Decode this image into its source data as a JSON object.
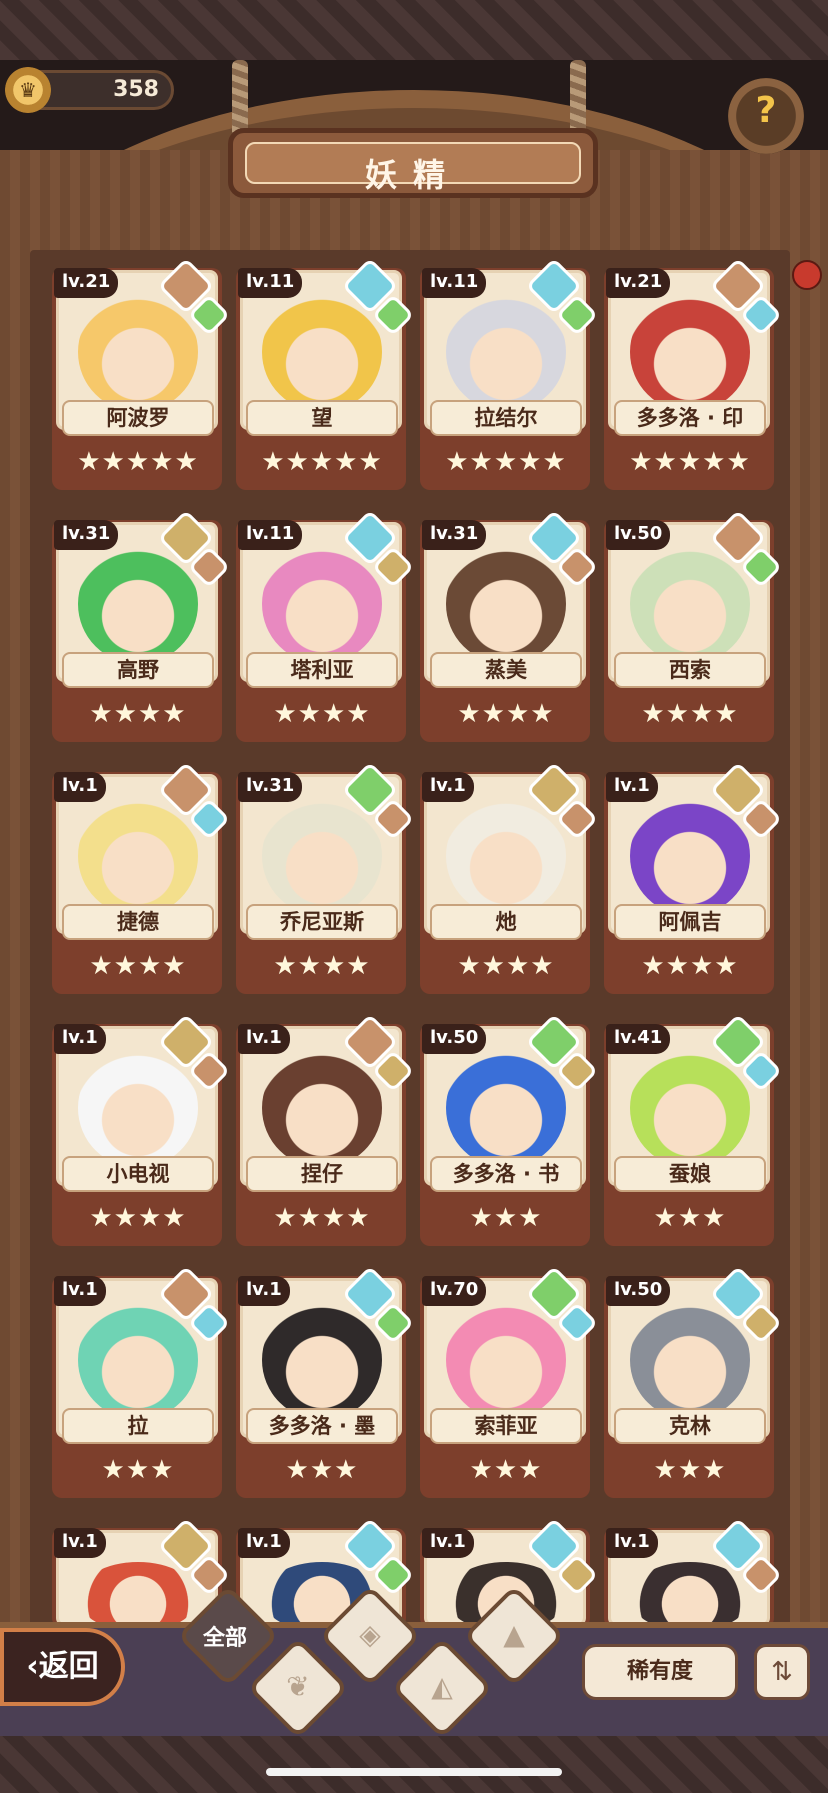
{
  "header": {
    "currency": "358",
    "title": "妖精"
  },
  "fairies": [
    {
      "level": "lv.21",
      "name": "阿波罗",
      "stars": "★★★★★",
      "main": "mountain",
      "sub": "leaf",
      "skin": "#f6c86a"
    },
    {
      "level": "lv.11",
      "name": "望",
      "stars": "★★★★★",
      "main": "water",
      "sub": "leaf",
      "skin": "#f1c54a"
    },
    {
      "level": "lv.11",
      "name": "拉结尔",
      "stars": "★★★★★",
      "main": "water",
      "sub": "leaf",
      "skin": "#d7d7de"
    },
    {
      "level": "lv.21",
      "name": "多多洛 · 印",
      "stars": "★★★★★",
      "main": "mountain",
      "sub": "water",
      "skin": "#c8433a"
    },
    {
      "level": "lv.31",
      "name": "高野",
      "stars": "★★★★",
      "main": "earth",
      "sub": "mountain",
      "skin": "#4dbf5d"
    },
    {
      "level": "lv.11",
      "name": "塔利亚",
      "stars": "★★★★",
      "main": "water",
      "sub": "earth",
      "skin": "#e889c0"
    },
    {
      "level": "lv.31",
      "name": "蒸美",
      "stars": "★★★★",
      "main": "water",
      "sub": "mountain",
      "skin": "#6b4a36"
    },
    {
      "level": "lv.50",
      "name": "西索",
      "stars": "★★★★",
      "main": "mountain",
      "sub": "leaf",
      "skin": "#cde0b8"
    },
    {
      "level": "lv.1",
      "name": "捷德",
      "stars": "★★★★",
      "main": "mountain",
      "sub": "water",
      "skin": "#f3df8c"
    },
    {
      "level": "lv.31",
      "name": "乔尼亚斯",
      "stars": "★★★★",
      "main": "leaf",
      "sub": "mountain",
      "skin": "#e8e4cf"
    },
    {
      "level": "lv.1",
      "name": "灺",
      "stars": "★★★★",
      "main": "earth",
      "sub": "mountain",
      "skin": "#f1ece0"
    },
    {
      "level": "lv.1",
      "name": "阿佩吉",
      "stars": "★★★★",
      "main": "earth",
      "sub": "mountain",
      "skin": "#7b45c7"
    },
    {
      "level": "lv.1",
      "name": "小电视",
      "stars": "★★★★",
      "main": "earth",
      "sub": "mountain",
      "skin": "#f6f6f6"
    },
    {
      "level": "lv.1",
      "name": "捏仔",
      "stars": "★★★★",
      "main": "mountain",
      "sub": "earth",
      "skin": "#6a4030"
    },
    {
      "level": "lv.50",
      "name": "多多洛 · 书",
      "stars": "★★★",
      "main": "leaf",
      "sub": "earth",
      "skin": "#3a6fd8"
    },
    {
      "level": "lv.41",
      "name": "蚕娘",
      "stars": "★★★",
      "main": "leaf",
      "sub": "water",
      "skin": "#b7e05a"
    },
    {
      "level": "lv.1",
      "name": "拉",
      "stars": "★★★",
      "main": "mountain",
      "sub": "water",
      "skin": "#6fd3b4"
    },
    {
      "level": "lv.1",
      "name": "多多洛 · 墨",
      "stars": "★★★",
      "main": "water",
      "sub": "leaf",
      "skin": "#2f2a2a"
    },
    {
      "level": "lv.70",
      "name": "索菲亚",
      "stars": "★★★",
      "main": "leaf",
      "sub": "water",
      "skin": "#f38bb3"
    },
    {
      "level": "lv.50",
      "name": "克林",
      "stars": "★★★",
      "main": "water",
      "sub": "earth",
      "skin": "#8a8f98"
    },
    {
      "level": "lv.1",
      "name": "",
      "stars": "",
      "main": "earth",
      "sub": "mountain",
      "skin": "#d9533b"
    },
    {
      "level": "lv.1",
      "name": "",
      "stars": "",
      "main": "water",
      "sub": "leaf",
      "skin": "#2f4a7a"
    },
    {
      "level": "lv.1",
      "name": "",
      "stars": "",
      "main": "water",
      "sub": "earth",
      "skin": "#3a302c"
    },
    {
      "level": "lv.1",
      "name": "",
      "stars": "",
      "main": "water",
      "sub": "mountain",
      "skin": "#3a2f30"
    }
  ],
  "bottom": {
    "back_label": "返回",
    "filter_all": "全部",
    "rarity_label": "稀有度",
    "sort_icon": "sort-icon"
  },
  "colors": {
    "frame": "#6f4a32",
    "card_border": "#7d3f2c",
    "bottom_bar": "#4b3f54"
  }
}
